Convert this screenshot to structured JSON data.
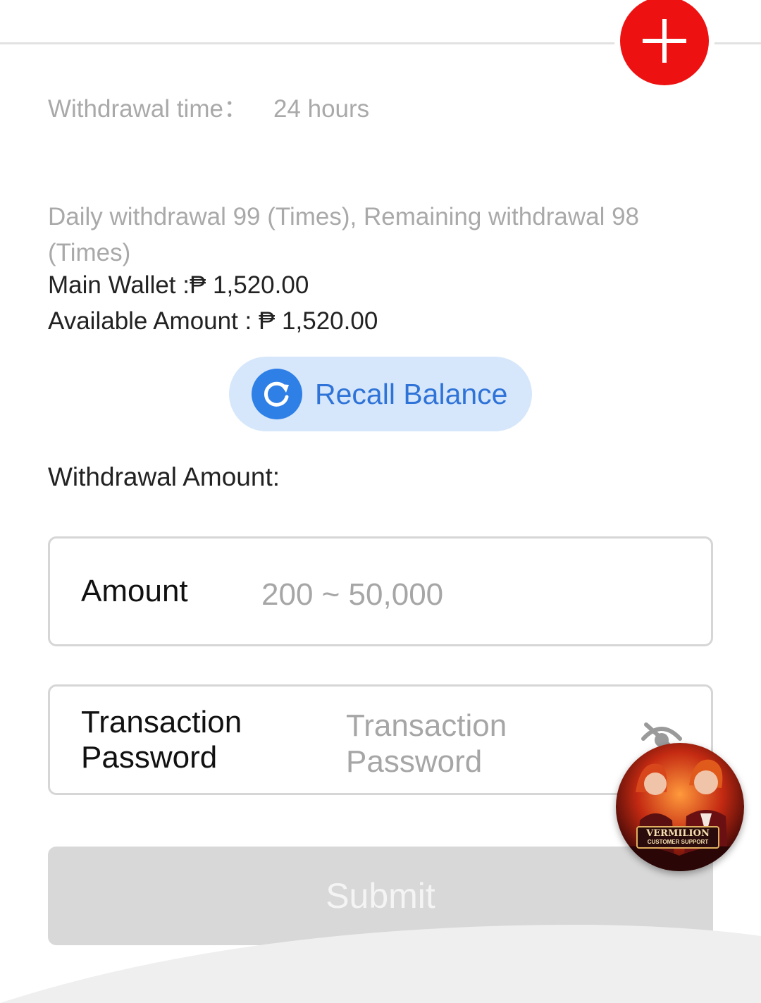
{
  "header": {
    "add_icon": "plus-icon",
    "add_color": "#ee1111"
  },
  "info": {
    "withdrawal_time_label": "Withdrawal time：",
    "withdrawal_time_value": "24 hours",
    "limits_text": "Daily withdrawal 99 (Times), Remaining withdrawal 98 (Times)",
    "main_wallet": "Main Wallet :₱ 1,520.00",
    "available_amount": "Available Amount : ₱ 1,520.00"
  },
  "recall": {
    "label": "Recall Balance",
    "icon": "refresh-icon",
    "accent": "#2e7fe6"
  },
  "form": {
    "section_label": "Withdrawal Amount:",
    "amount_label": "Amount",
    "amount_placeholder": "200 ~ 50,000",
    "password_label": "Transaction Password",
    "password_placeholder": "Transaction Password",
    "password_toggle_icon": "eye-hidden-icon",
    "submit_label": "Submit"
  },
  "support": {
    "title": "VERMILION",
    "subtitle": "CUSTOMER SUPPORT"
  }
}
